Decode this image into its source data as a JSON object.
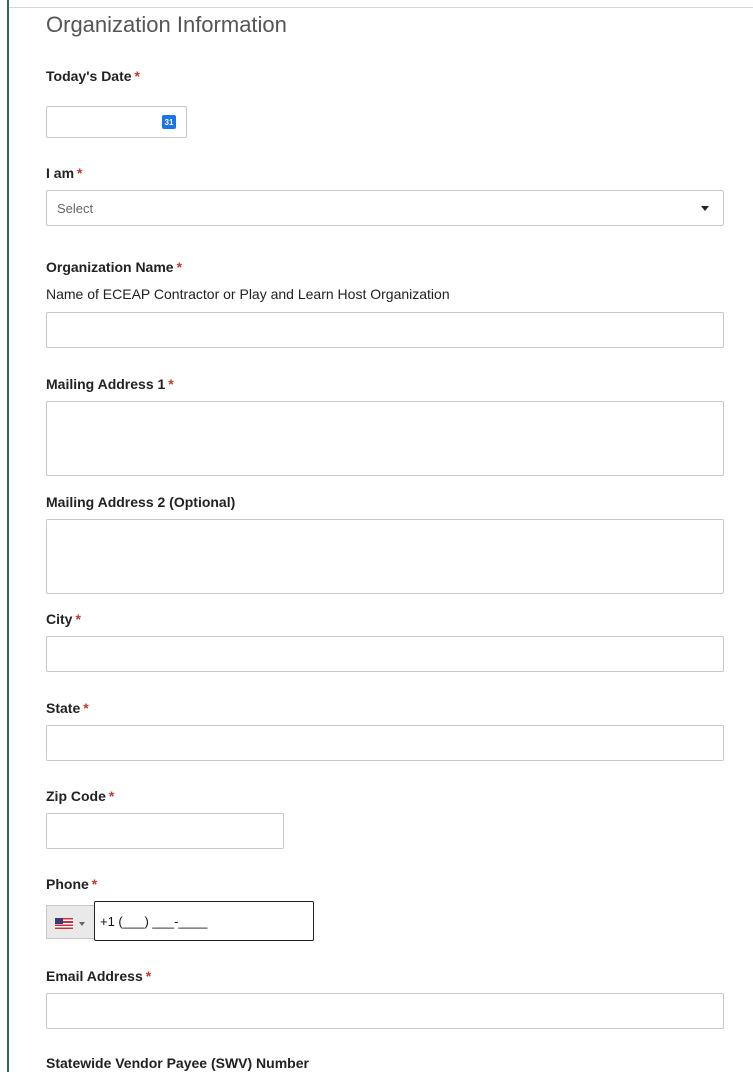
{
  "form": {
    "section_title": "Organization Information",
    "required_marker": "*",
    "todays_date": {
      "label": "Today's Date",
      "value": "",
      "icon": "calendar-icon",
      "icon_text": "31"
    },
    "i_am": {
      "label": "I am",
      "selected": "Select"
    },
    "organization_name": {
      "label": "Organization Name",
      "help": "Name of ECEAP Contractor or Play and Learn Host Organization",
      "value": ""
    },
    "mailing_address_1": {
      "label": "Mailing Address 1",
      "value": ""
    },
    "mailing_address_2": {
      "label": "Mailing Address 2 (Optional)",
      "value": ""
    },
    "city": {
      "label": "City",
      "value": ""
    },
    "state": {
      "label": "State",
      "value": ""
    },
    "zip_code": {
      "label": "Zip Code",
      "value": ""
    },
    "phone": {
      "label": "Phone",
      "country_icon": "us-flag-icon",
      "mask": "+1 (___) ___-____"
    },
    "email": {
      "label": "Email Address",
      "value": ""
    },
    "swv_number": {
      "label": "Statewide Vendor Payee (SWV) Number"
    }
  },
  "colors": {
    "accent_bar": "#2f6b55",
    "required": "#c0392b",
    "calendar": "#1a73e8"
  }
}
